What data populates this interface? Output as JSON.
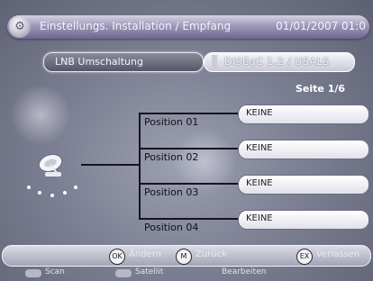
{
  "header": {
    "title": "Einstellungs. Installation / Empfang",
    "datetime": "01/01/2007 01:0",
    "icon": "settings-icon"
  },
  "lnb": {
    "label": "LNB Umschaltung",
    "value": "DiSEqC 1.2 / USALS"
  },
  "page": {
    "indicator": "Seite 1/6"
  },
  "positions": [
    {
      "label": "Position  01",
      "value": "KEINE"
    },
    {
      "label": "Position  02",
      "value": "KEINE"
    },
    {
      "label": "Position  03",
      "value": "KEINE"
    },
    {
      "label": "Position  04",
      "value": "KEINE"
    }
  ],
  "footer": {
    "keys": [
      {
        "icon": "ok-key-icon",
        "label": "Ändern"
      },
      {
        "icon": "menu-key-icon",
        "label": "Zurück"
      },
      {
        "icon": "exit-key-icon",
        "label": "Verlassen"
      }
    ],
    "color_buttons": [
      {
        "label": "Scan"
      },
      {
        "label": "Satellit"
      },
      {
        "label": "Bearbeiten"
      }
    ]
  },
  "colors": {
    "background": "#7d8094",
    "title_bar": "#9b95b6",
    "slot": "#ffffff",
    "line": "#15151c"
  }
}
